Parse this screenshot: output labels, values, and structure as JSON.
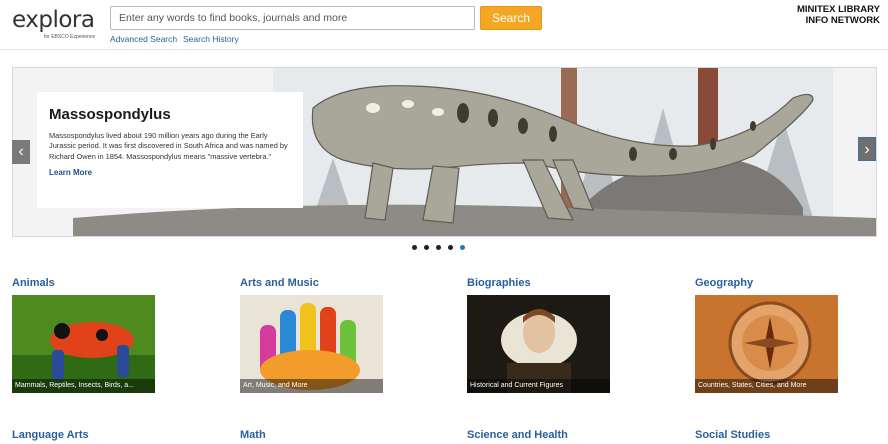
{
  "header": {
    "logo_text": "explora",
    "logo_sub": "for EBSCO Experience",
    "search_placeholder": "Enter any words to find books, journals and more",
    "search_button": "Search",
    "advanced_search": "Advanced Search",
    "search_history": "Search History",
    "library_line1": "MINITEX LIBRARY",
    "library_line2": "INFO NETWORK"
  },
  "carousel": {
    "title": "Massospondylus",
    "body": "Massospondylus lived about 190 million years ago during the Early Jurassic period. It was first discovered in South Africa and was named by Richard Owen in 1854. Massospondylus means \"massive vertebra.\"",
    "link": "Learn More",
    "prev_icon": "‹",
    "next_icon": "›",
    "slide_count": 5,
    "active_slide": 5
  },
  "categories": [
    {
      "title": "Animals",
      "caption": "Mammals, Reptiles, Insects, Birds, a..."
    },
    {
      "title": "Arts and Music",
      "caption": "Art, Music, and More"
    },
    {
      "title": "Biographies",
      "caption": "Historical and Current Figures"
    },
    {
      "title": "Geography",
      "caption": "Countries, States, Cities, and More"
    },
    {
      "title": "Language Arts",
      "caption": ""
    },
    {
      "title": "Math",
      "caption": ""
    },
    {
      "title": "Science and Health",
      "caption": ""
    },
    {
      "title": "Social Studies",
      "caption": ""
    }
  ],
  "colors": {
    "accent": "#f5a623",
    "link": "#2a5f9e",
    "active_dot": "#2a73c5"
  }
}
